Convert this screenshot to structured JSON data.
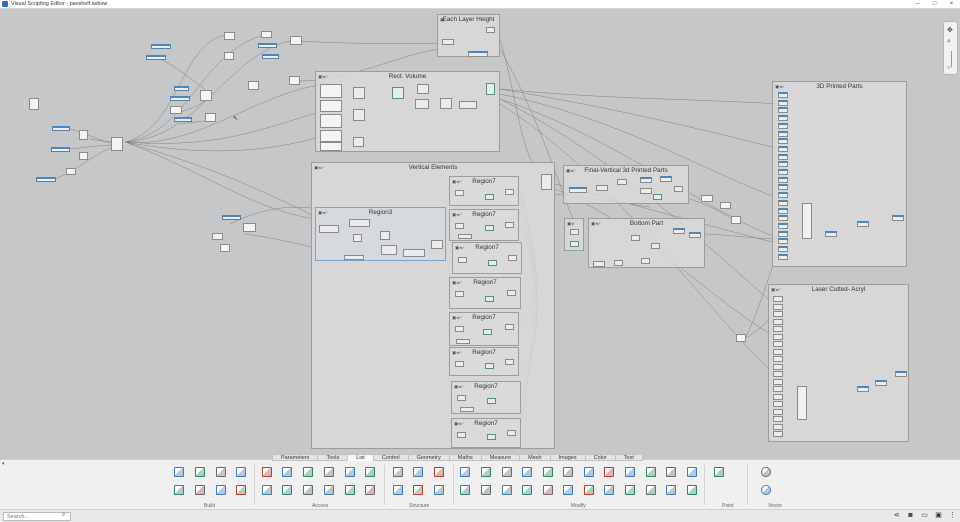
{
  "window": {
    "title": "Visual Scripting Editor - pavshelf.sebvw",
    "minimize": "–",
    "maximize": "□",
    "close": "×"
  },
  "groups": {
    "each_layer_height": "Each Layer Height",
    "rect_volume": "Rect. Volume",
    "vertical_elements": "Vertical Elements",
    "region3": "Region3",
    "region7": "Region7",
    "final_vertical": "Final-Vertical 3d Printed Parts",
    "bottom_part": "Bottom Part",
    "printed_parts": "3D Printed Parts",
    "laser_cutted": "Laser Cutted- Acryl"
  },
  "zoom": {
    "pan": "✥",
    "zoom_in": "⌕",
    "zoom_out": "○"
  },
  "ribbon": {
    "tabs": [
      "Parameters",
      "Tools",
      "List",
      "Control",
      "Geometry",
      "Maths",
      "Measure",
      "Mesh",
      "Images",
      "Color",
      "Text"
    ],
    "active_tab": "List",
    "sections": [
      "Build",
      "Access",
      "Structure",
      "Modify",
      "Point",
      "Vector"
    ],
    "expander": "▾"
  },
  "status": {
    "search_placeholder": "Search...",
    "icons": [
      "share-icon",
      "camera-icon",
      "save-icon",
      "image-icon",
      "more-icon"
    ]
  }
}
